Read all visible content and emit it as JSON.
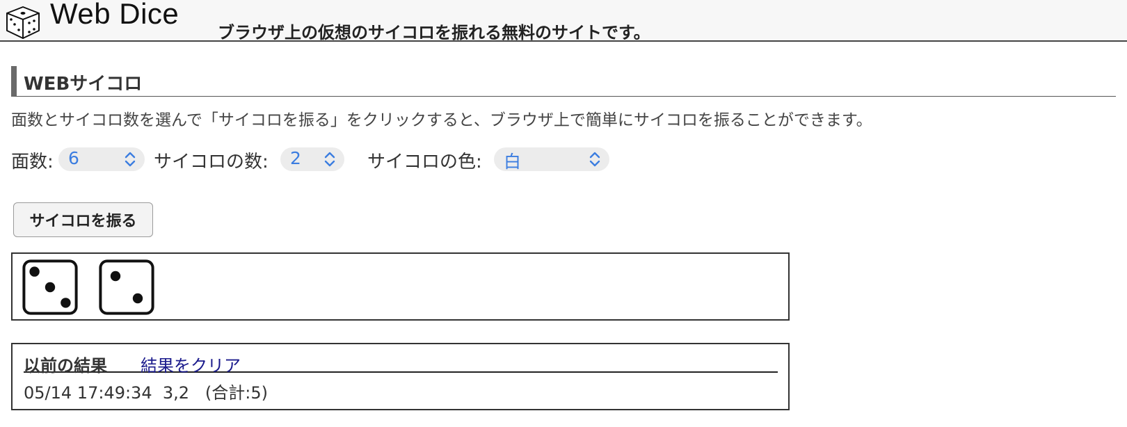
{
  "header": {
    "logo_icon": "dice-icon",
    "app_title": "Web Dice",
    "tagline": "ブラウザ上の仮想のサイコロを振れる無料のサイトです。"
  },
  "section": {
    "heading": "WEBサイコロ",
    "description": "面数とサイコロ数を選んで「サイコロを振る」をクリックすると、ブラウザ上で簡単にサイコロを振ることができます。"
  },
  "controls": {
    "faces": {
      "label": "面数:",
      "value": "6"
    },
    "count": {
      "label": "サイコロの数:",
      "value": "2"
    },
    "color": {
      "label": "サイコロの色:",
      "value": "白"
    },
    "chevron_icon": "chevron-up-down-icon"
  },
  "roll_button": {
    "label": "サイコロを振る"
  },
  "dice_results": [
    3,
    2
  ],
  "history": {
    "title": "以前の結果",
    "clear_link": "結果をクリア",
    "entries": [
      "05/14 17:49:34  3,2   (合計:5)"
    ]
  },
  "colors": {
    "accent_blue": "#3b7de0",
    "link": "#1a1a8c",
    "heading_bar": "#6a6a6a"
  }
}
